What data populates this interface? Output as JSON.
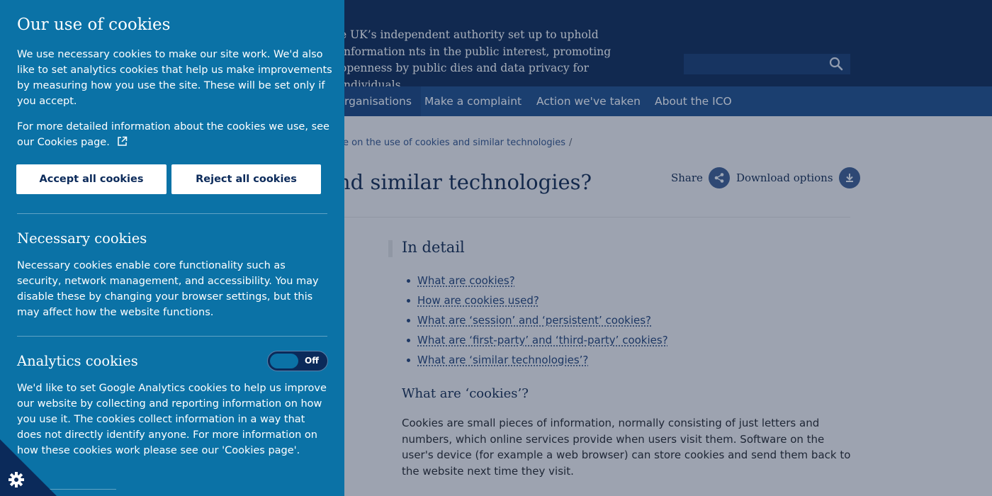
{
  "header": {
    "tagline": "e UK’s independent authority set up to uphold information nts in the public interest, promoting openness by public dies and data privacy for individuals."
  },
  "nav": {
    "items": [
      "rganisations",
      "Make a complaint",
      "Action we've taken",
      "About the ICO"
    ]
  },
  "breadcrumb": {
    "text": "e on the use of cookies and similar technologies",
    "separator": "/"
  },
  "page": {
    "title": "nd similar technologies?",
    "share_label": "Share",
    "download_label": "Download options",
    "in_detail_heading": "In detail",
    "toc": [
      "What are cookies?",
      "How are cookies used?",
      "What are ‘session’ and ‘persistent’ cookies?",
      "What are ‘first-party’ and ‘third-party’ cookies?",
      "What are ‘similar technologies’?"
    ],
    "section_heading": "What are ‘cookies’?",
    "section_body": "Cookies are small pieces of information, normally consisting of just letters and numbers, which online services provide when users visit them. Software on the user's device (for example a web browser) can store cookies and send them back to the website next time they visit."
  },
  "cookie_panel": {
    "title": "Our use of cookies",
    "intro": "We use necessary cookies to make our site work. We'd also like to set analytics cookies that help us make improvements by measuring how you use the site. These will be set only if you accept.",
    "more_info": "For more detailed information about the cookies we use, see our Cookies page.",
    "accept_label": "Accept all cookies",
    "reject_label": "Reject all cookies",
    "necessary_heading": "Necessary cookies",
    "necessary_text": "Necessary cookies enable core functionality such as security, network management, and accessibility. You may disable these by changing your browser settings, but this may affect how the website functions.",
    "analytics_heading": "Analytics cookies",
    "analytics_toggle_label": "Off",
    "analytics_text": "We'd like to set Google Analytics cookies to help us improve our website by collecting and reporting information on how you use it. The cookies collect information in a way that does not directly identify anyone. For more information on how these cookies work please see our 'Cookies page'."
  },
  "colors": {
    "panel_bg": "#0b72a6",
    "header_bg": "#0b2a5a",
    "nav_bg": "#1a4a8a"
  }
}
